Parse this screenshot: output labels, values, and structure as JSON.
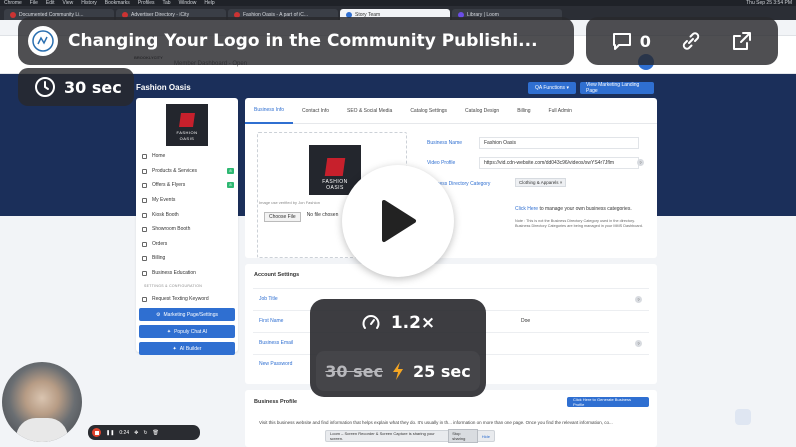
{
  "browser": {
    "menu": [
      "Chrome",
      "File",
      "Edit",
      "View",
      "History",
      "Bookmarks",
      "Profiles",
      "Tab",
      "Window",
      "Help"
    ],
    "clock": "Thu Sep 25 3:54 PM",
    "tabs": [
      {
        "label": "Documented Community Li...",
        "active": false
      },
      {
        "label": "Advertiser Directory - iCity",
        "active": false
      },
      {
        "label": "Fashion Oasis - A part of iC...",
        "active": false
      },
      {
        "label": "Story Team",
        "active": true
      },
      {
        "label": "Library | Loom",
        "active": false
      }
    ]
  },
  "site": {
    "logo_text": "BROOKLYCITY",
    "member_link": "Member Dashboard - Open"
  },
  "header": {
    "business_title": "Fashion Oasis",
    "qa_button": "QA Functions",
    "marketing_button": "View Marketing Landing Page"
  },
  "sidebar": {
    "logo_line1": "FASHION",
    "logo_line2": "OASIS",
    "items": [
      {
        "label": "Home",
        "badge": ""
      },
      {
        "label": "Products & Services",
        "badge": "8"
      },
      {
        "label": "Offers & Flyers",
        "badge": "8"
      },
      {
        "label": "My Events",
        "badge": ""
      },
      {
        "label": "Kiosk Booth",
        "badge": ""
      },
      {
        "label": "Showroom Booth",
        "badge": ""
      },
      {
        "label": "Orders",
        "badge": ""
      },
      {
        "label": "Billing",
        "badge": ""
      },
      {
        "label": "Business Education",
        "badge": ""
      }
    ],
    "section_label": "SETTINGS & CONFIGURATION",
    "request_item": "Request Texting Keyword",
    "buttons": [
      "Marketing Page/Settings",
      "Populy Chat AI",
      "AI Builder"
    ]
  },
  "main": {
    "tabs": [
      "Business Info",
      "Contact Info",
      "SEO & Social Media",
      "Catalog Settings",
      "Catalog Design",
      "Billing",
      "Full Admin"
    ],
    "logo_line1": "FASHION",
    "logo_line2": "OASIS",
    "image_note": "Image use verified by Jon Fashion",
    "choose_file": "Choose File",
    "no_file": "No file chosen",
    "fields": [
      {
        "label": "Business Name",
        "value": "Fashion Oasis"
      },
      {
        "label": "Video Profile",
        "value": "https://vid.cdn-website.com/dd043c96/videos/swYS4r7Jflm"
      },
      {
        "label": "Business Directory Category",
        "value": ""
      }
    ],
    "category_chip": "Clothing & Apparels",
    "click_here": "Click Here",
    "click_here_rest": "to manage your own business categories.",
    "note": "Note : This is not the Business Directory Category used in the directory. Business Directory Categories are being managed in your MMS Dashboard."
  },
  "account": {
    "title": "Account Settings",
    "rows": [
      "Job Title",
      "First Name",
      "Business Email",
      "New Password"
    ],
    "last_name_value": "Doe"
  },
  "profile": {
    "title": "Business Profile",
    "button": "Click Here to Generate Business Profile",
    "text": "Visit this business website and find information that helps explain what they do. It's usually in th... information on more than one page. Once you find the relevant information, co..."
  },
  "screen_share": {
    "text": "Loom – Screen Recorder & Screen Capture is sharing your screen.",
    "stop": "Stop sharing",
    "hide": "Hide"
  },
  "overlay": {
    "title": "Changing Your Logo in the Community Publishi...",
    "comment_count": "0",
    "duration": "30 sec",
    "speed": "1.2×",
    "old_duration": "30 sec",
    "new_duration": "25 sec",
    "recorder_time": "0:24"
  }
}
